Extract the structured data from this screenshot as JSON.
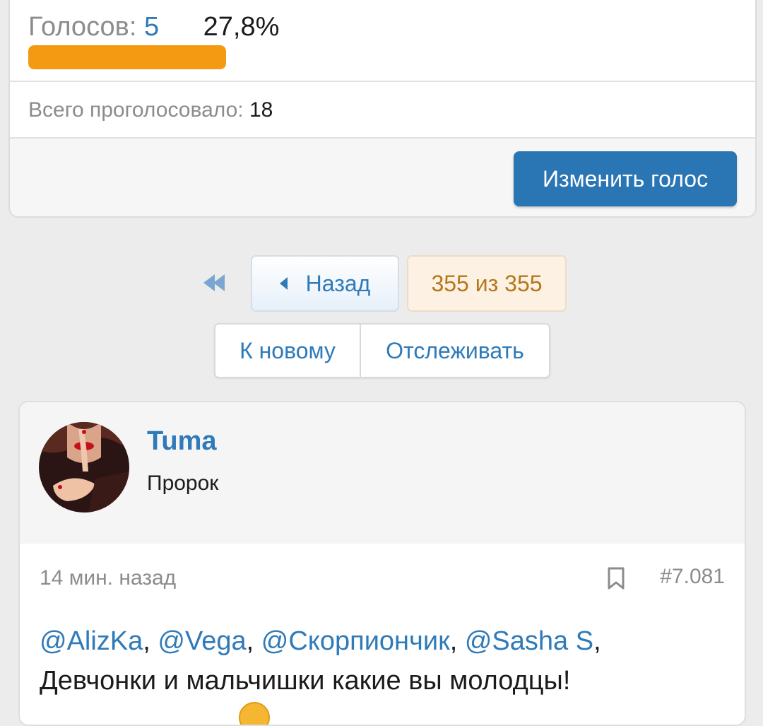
{
  "poll": {
    "votes_label": "Голосов:",
    "votes_count": "5",
    "percent": "27,8%",
    "bar_fraction": 0.278,
    "bar_color": "#f39a12",
    "total_label": "Всего проголосовало:",
    "total_count": "18",
    "change_vote_label": "Изменить голос"
  },
  "pagination": {
    "first_icon": "double-chevron-left-icon",
    "back_label": "Назад",
    "page_count": "355 из 355",
    "to_new_label": "К новому",
    "watch_label": "Отслеживать"
  },
  "post": {
    "username": "Tuma",
    "user_title": "Пророк",
    "time": "14 мин. назад",
    "bookmark_icon": "bookmark-icon",
    "post_number": "#7.081",
    "mentions": [
      "@AlizKa",
      "@Vega",
      "@Скорпиончик",
      "@Sasha S"
    ],
    "body_text": "Девчонки и мальчишки какие вы молодцы!"
  },
  "colors": {
    "accent": "#2a75b3",
    "link": "#2f7ab8",
    "page_bg": "#ececec"
  }
}
